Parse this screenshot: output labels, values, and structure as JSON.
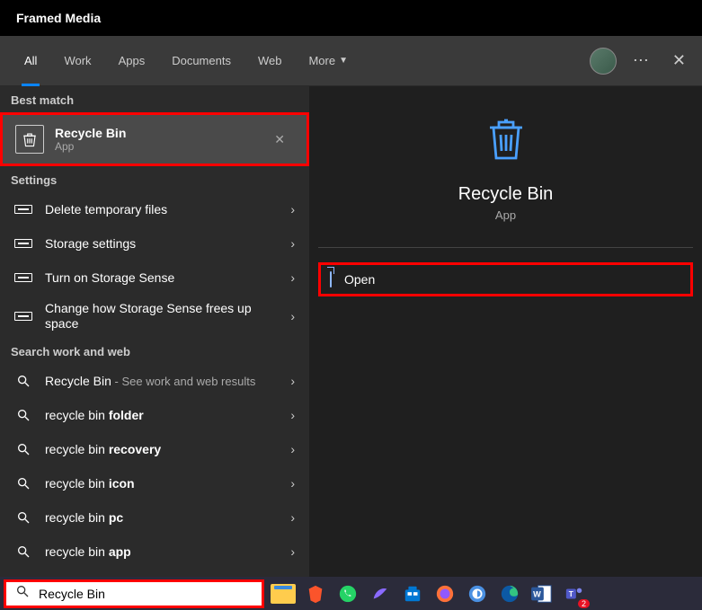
{
  "title": "Framed Media",
  "tabs": {
    "items": [
      "All",
      "Work",
      "Apps",
      "Documents",
      "Web",
      "More"
    ],
    "active": 0
  },
  "left": {
    "best_match_label": "Best match",
    "best": {
      "title": "Recycle Bin",
      "sub": "App"
    },
    "settings_label": "Settings",
    "settings_items": [
      "Delete temporary files",
      "Storage settings",
      "Turn on Storage Sense",
      "Change how Storage Sense frees up space"
    ],
    "web_label": "Search work and web",
    "web_items": [
      {
        "prefix": "Recycle Bin",
        "suffix": " - See work and web results"
      },
      {
        "prefix": "recycle bin ",
        "suffix": "folder"
      },
      {
        "prefix": "recycle bin ",
        "suffix": "recovery"
      },
      {
        "prefix": "recycle bin ",
        "suffix": "icon"
      },
      {
        "prefix": "recycle bin ",
        "suffix": "pc"
      },
      {
        "prefix": "recycle bin ",
        "suffix": "app"
      }
    ]
  },
  "right": {
    "title": "Recycle Bin",
    "sub": "App",
    "open_label": "Open"
  },
  "search": {
    "value": "Recycle Bin"
  }
}
